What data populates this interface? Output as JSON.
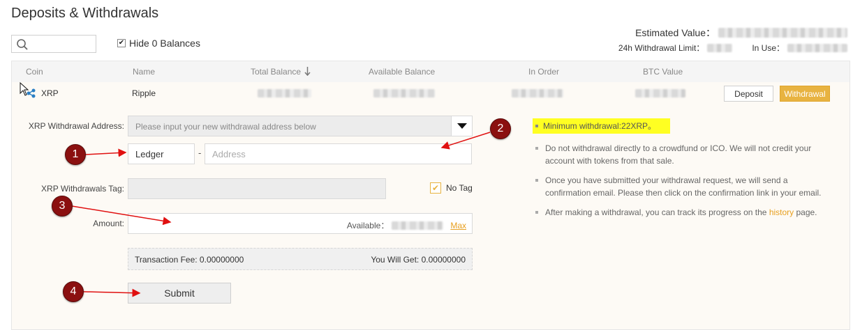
{
  "page": {
    "title": "Deposits & Withdrawals"
  },
  "search": {
    "placeholder": ""
  },
  "filters": {
    "hide_zero_label": "Hide 0 Balances",
    "hide_zero_checked": true
  },
  "summary": {
    "estimated_label": "Estimated Value：",
    "limit_label": "24h Withdrawal Limit：",
    "in_use_label": "In Use："
  },
  "table": {
    "headers": [
      "Coin",
      "Name",
      "Total Balance",
      "Available Balance",
      "In Order",
      "BTC Value"
    ],
    "row": {
      "coin": "XRP",
      "name": "Ripple",
      "deposit_label": "Deposit",
      "withdrawal_label": "Withdrawal"
    }
  },
  "form": {
    "address_label": "XRP Withdrawal Address:",
    "address_select_placeholder": "Please input your new withdrawal address below",
    "label_value": "Ledger",
    "address_placeholder": "Address",
    "tag_label": "XRP Withdrawals Tag:",
    "no_tag_label": "No Tag",
    "amount_label": "Amount:",
    "available_label": "Available：",
    "max_label": "Max",
    "fee_text": "Transaction Fee: 0.00000000",
    "you_get_text": "You Will Get: 0.00000000",
    "submit_label": "Submit"
  },
  "notes": {
    "min": "Minimum withdrawal:22XRP。",
    "crowdfund": "Do not withdrawal directly to a crowdfund or ICO. We will not credit your account with tokens from that sale.",
    "email": "Once you have submitted your withdrawal request, we will send a confirmation email. Please then click on the confirmation link in your email.",
    "history_before": "After making a withdrawal, you can track its progress on the ",
    "history_link": "history",
    "history_after": " page."
  },
  "markers": [
    "1",
    "2",
    "3",
    "4"
  ],
  "colors": {
    "accent": "#e8b341",
    "highlight": "#ffff22",
    "marker": "#8b1010",
    "arrow": "#e01010"
  }
}
